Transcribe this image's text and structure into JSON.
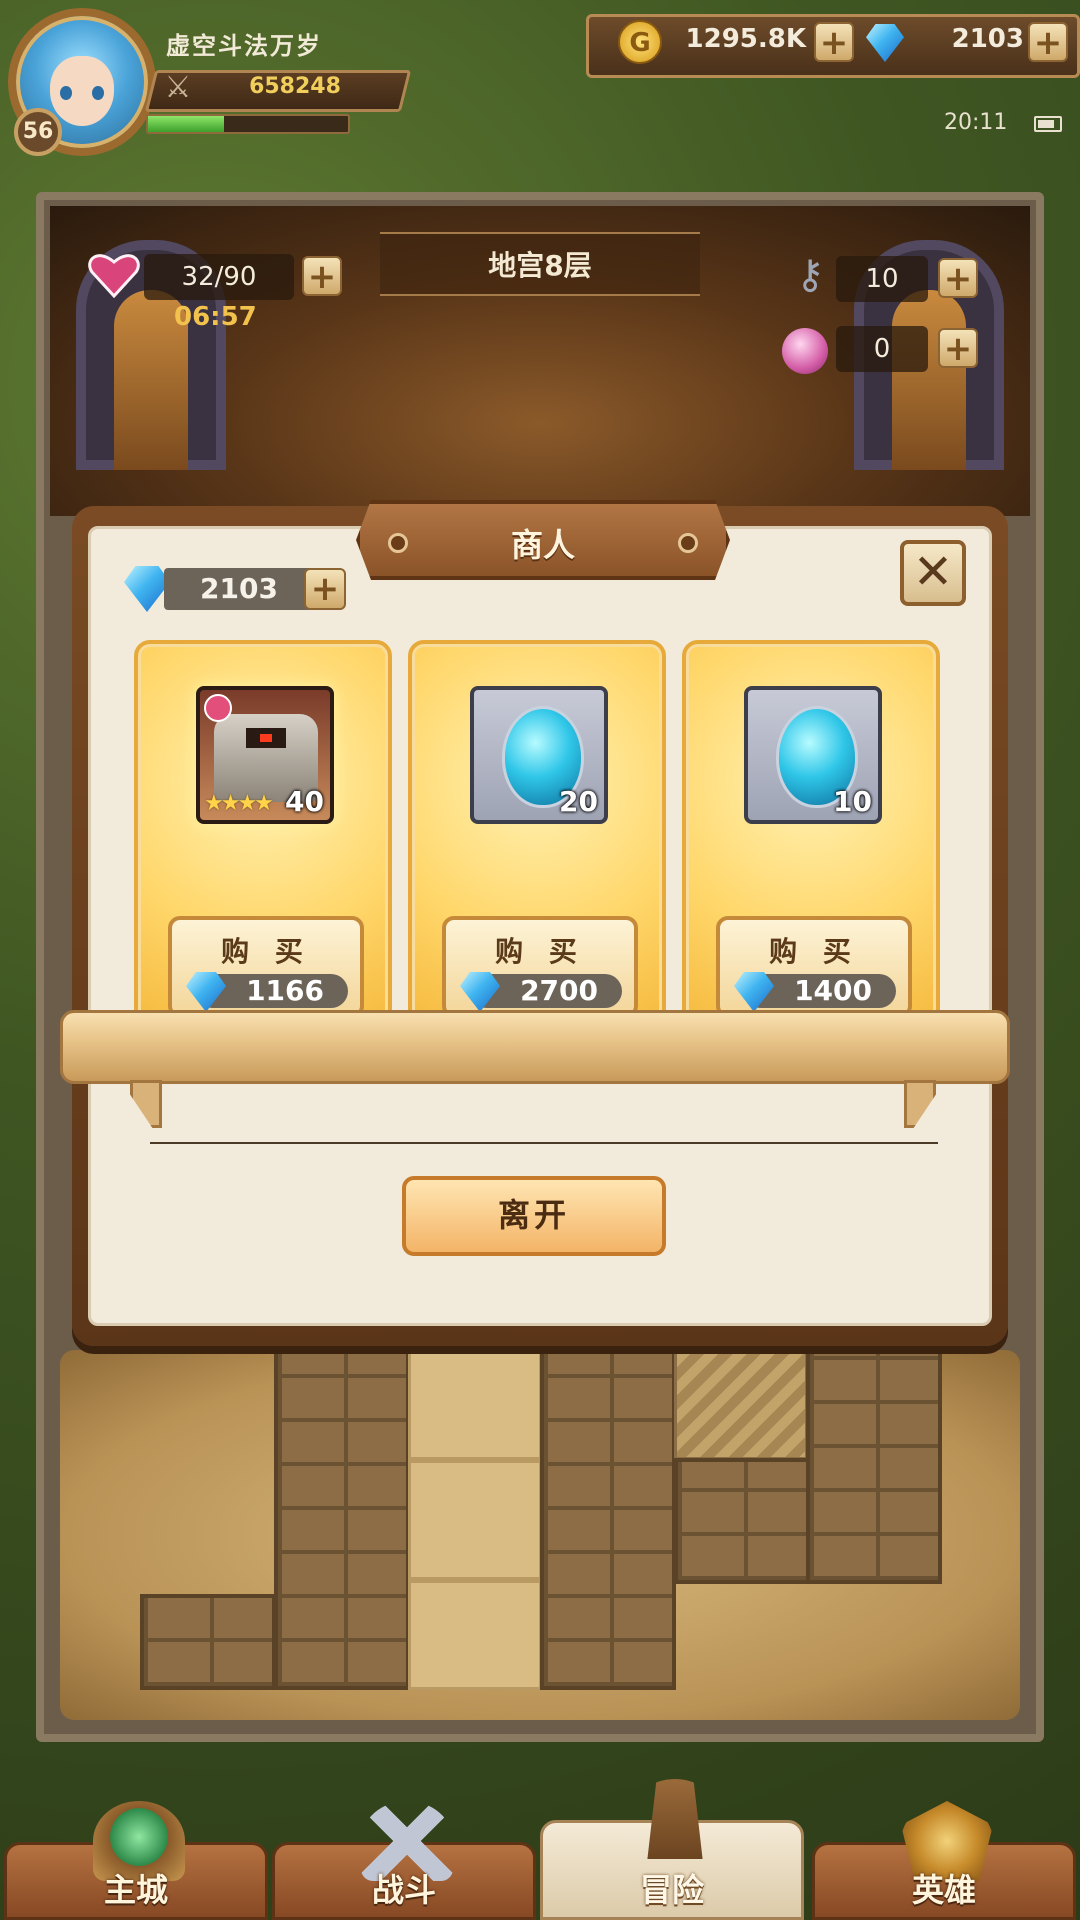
{
  "player": {
    "name": "虚空斗法万岁",
    "level": "56",
    "power": "658248",
    "exp_progress": 0.38
  },
  "currency": {
    "gold": "1295.8K",
    "gems": "2103"
  },
  "status": {
    "time": "20:11"
  },
  "dungeon": {
    "floor": "地宫8层",
    "stamina": "32/90",
    "stamina_timer": "06:57",
    "keys": "10",
    "orbs": "0"
  },
  "merchant": {
    "title": "商人",
    "gem_balance": "2103",
    "items": [
      {
        "type": "hero",
        "quantity": "40",
        "stars": "★★★★",
        "buy_label": "购 买",
        "price": "1166"
      },
      {
        "type": "egg",
        "quantity": "20",
        "buy_label": "购 买",
        "price": "2700"
      },
      {
        "type": "egg",
        "quantity": "10",
        "buy_label": "购 买",
        "price": "1400"
      }
    ],
    "leave_label": "离开"
  },
  "nav": {
    "tabs": [
      {
        "label": "主城",
        "icon": "city-icon"
      },
      {
        "label": "战斗",
        "icon": "crossed-swords-icon"
      },
      {
        "label": "冒险",
        "icon": "adventure-icon",
        "active": true
      },
      {
        "label": "英雄",
        "icon": "hero-helmet-icon"
      }
    ]
  },
  "colors": {
    "gold_text": "#f1cf5d",
    "timer_text": "#f3c24d",
    "gem_blue": "#3fb4f0",
    "panel_bg": "#f2ebdb",
    "card_gold": "#ffd76b"
  }
}
